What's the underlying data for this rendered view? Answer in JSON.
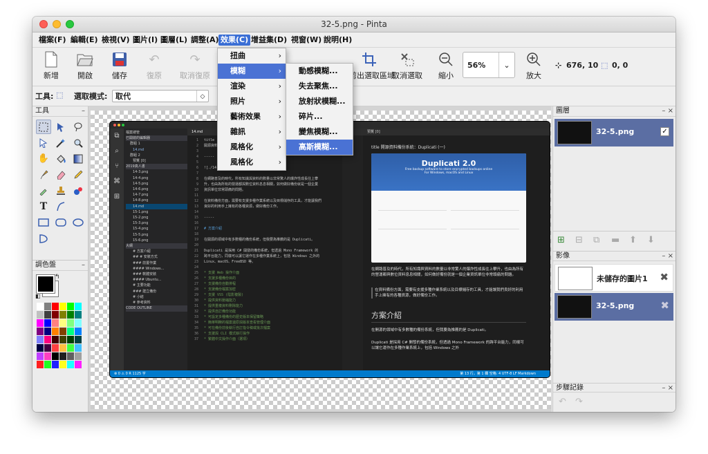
{
  "window": {
    "title": "32-5.png - Pinta"
  },
  "menubar": [
    {
      "label": "檔案(F)"
    },
    {
      "label": "編輯(E)"
    },
    {
      "label": "檢視(V)"
    },
    {
      "label": "圖片(I)"
    },
    {
      "label": "圖層(L)"
    },
    {
      "label": "調整(A)"
    },
    {
      "label": "效果(C)"
    },
    {
      "label": "增益集(D)"
    },
    {
      "label": "視窗(W)"
    },
    {
      "label": "說明(H)"
    }
  ],
  "toolbar": {
    "new": "新增",
    "open": "開啟",
    "save": "儲存",
    "undo": "復原",
    "redo": "取消復原",
    "crop": "裁剪出選取區域",
    "deselect": "取消選取",
    "zoom_out": "縮小",
    "zoom_in": "放大",
    "zoom_value": "56%",
    "cursor_pos": "676, 10",
    "selection_size": "0, 0"
  },
  "toolrow": {
    "tool_label": "工具:",
    "select_mode_label": "選取模式:",
    "select_mode_value": "取代"
  },
  "effects_menu": [
    {
      "label": "扭曲"
    },
    {
      "label": "模糊"
    },
    {
      "label": "渲染"
    },
    {
      "label": "照片"
    },
    {
      "label": "藝術效果"
    },
    {
      "label": "雜訊"
    },
    {
      "label": "風格化"
    },
    {
      "label": "風格化"
    }
  ],
  "blur_submenu": [
    {
      "label": "動感模糊..."
    },
    {
      "label": "失去聚焦..."
    },
    {
      "label": "放射狀模糊..."
    },
    {
      "label": "碎片..."
    },
    {
      "label": "變焦模糊..."
    },
    {
      "label": "高斯模糊..."
    }
  ],
  "panels": {
    "tools": "工具",
    "palette": "調色盤",
    "layers": "圖層",
    "images": "影像",
    "history": "步驟記錄",
    "minimize": "–",
    "close": "×"
  },
  "layers": [
    {
      "name": "32-5.png",
      "visible": true
    }
  ],
  "images": [
    {
      "name": "未儲存的圖片1"
    },
    {
      "name": "32-5.png"
    }
  ],
  "screenshot_content": {
    "sidebar_title": "檔案總管",
    "sidebar_section": "已開啟的編輯器",
    "group1": "群組 1",
    "open_file": "14.md",
    "group2": "群組 2",
    "preview_item": "預覽 [0]",
    "folder": "2019真人書",
    "files": [
      "14-3.png",
      "14-4.png",
      "14-5.png",
      "14-6.png",
      "14-7.png",
      "14-8.png",
      "14.md",
      "15-1.png",
      "15-2.png",
      "15-3.png",
      "15-4.png",
      "15-5.png",
      "15-6.png"
    ],
    "outline_label": "大綱",
    "outline_items": [
      "# 方案介紹",
      "## # 安裝方式",
      "### 前置作業",
      "#### Windows...",
      "### 軟體安裝",
      "#### Ubuntu...",
      "# 主要功能",
      "### 建立備份",
      "# 小結",
      "# 參考資料"
    ],
    "code_outline": "CODE OUTLINE",
    "editor_tab": "14.md",
    "preview_tab": "預覽 [0]",
    "code_lines": [
      {
        "n": "1",
        "t": "title"
      },
      {
        "n": "2",
        "t": "開源資料備份系統：Duplicati (一)"
      },
      {
        "n": "3",
        "t": ""
      },
      {
        "n": "4",
        "t": "-----"
      },
      {
        "n": "5",
        "t": ""
      },
      {
        "n": "6",
        "t": "![./14-1.png](./14-1.png)"
      },
      {
        "n": "7",
        "t": ""
      },
      {
        "n": "8",
        "t": "在網路普及的時代，所有知識與資料的數量以非常驚人的爆炸性成長往上攀"
      },
      {
        "n": "9",
        "t": "升，也由為所有的營運都與數位資料息息相關，如何做好備份就是一個企業"
      },
      {
        "n": "10",
        "t": "資訊單位非常頭痛的問題。"
      },
      {
        "n": "11",
        "t": ""
      },
      {
        "n": "12",
        "t": "在資料備份方面，需要有支援多種作業系統以及目標儲存的工具，才能讓我們"
      },
      {
        "n": "13",
        "t": "良好的利用手上擁有的各種資源，做好備份工作。"
      },
      {
        "n": "14",
        "t": ""
      },
      {
        "n": "15",
        "t": "-----"
      },
      {
        "n": "16",
        "t": ""
      },
      {
        "n": "17",
        "t": "# 方案介紹"
      },
      {
        "n": "18",
        "t": ""
      },
      {
        "n": "19",
        "t": "在開源的領域中有多數種的備份系統，但我要為推薦的是 Duplicati。"
      },
      {
        "n": "20",
        "t": ""
      },
      {
        "n": "21",
        "t": "Duplicati 是採用 C# 開發的備份系統，但透過 Mono Framework 的"
      },
      {
        "n": "22",
        "t": "跨平台能力，同樣可以讓它運作在多種作業系統上，包括 Windows 之外的"
      },
      {
        "n": "23",
        "t": "Linux、macOS、FreeBSD 等。"
      },
      {
        "n": "24",
        "t": ""
      },
      {
        "n": "25",
        "t": "* 支援 Web 操作介面"
      },
      {
        "n": "26",
        "t": "* 支援多種備份目的"
      },
      {
        "n": "27",
        "t": "* 支援備份自動排程"
      },
      {
        "n": "28",
        "t": "* 支援備份檔案加密"
      },
      {
        "n": "29",
        "t": "* 支援 VSS (陰影複製)"
      },
      {
        "n": "30",
        "t": "* 提供資料壓縮能力"
      },
      {
        "n": "31",
        "t": "* 提供重複資料刪除能力"
      },
      {
        "n": "32",
        "t": "* 提供自訂備份功能"
      },
      {
        "n": "33",
        "t": "* 可設定多種備份的歷史版本保留策略"
      },
      {
        "n": "34",
        "t": "* 簡單明瞭的檔案還原與版本查看管理介面"
      },
      {
        "n": "35",
        "t": "* 可在備份前後執行自訂指令稿或批次檔案"
      },
      {
        "n": "36",
        "t": "* 支援與 CLI 模式執行操作"
      },
      {
        "n": "37",
        "t": "* 繁體中文操作介面（選項）"
      }
    ],
    "preview": {
      "h_title": "title 開源資料備份系統：Duplicati (一)",
      "hero_title": "Duplicati 2.0",
      "hero_sub": "Free backup software to store encrypted backups online",
      "hero_sub2": "For Windows, macOS and Linux",
      "p1": "在網路普及的時代，所有知識與資料的數量以非常驚人的爆炸性成長往上攀升，也由為所有的營運都與數位資料息息相關，如何做好備份就是一個企業資訊單位非常頭痛的問題。",
      "p2": "在資料備份方面，需要有支援多種作業系統以及目標儲存的工具，才能讓我們良好的利用手上擁有的各種資源，做好備份工作。",
      "h2": "方案介紹",
      "p3": "在開源的領域中有多數種的備份系統，但我要為推薦的是 Duplicati。",
      "p4": "Duplicati 是採用 C# 開發的備份系統，但透過 Mono Framework 的跨平台能力，同樣可以讓它運作在多種作業系統上，包括 Windows 之外"
    },
    "statusbar_left": "⊗ 0 ⚠ 0    R 1125 字",
    "statusbar_right": "第 13 行，第 1 欄   空格: 4   UTF-8   LF   Markdown"
  },
  "colors": {
    "accent": "#3b6fd6",
    "highlight": "#4a72d4",
    "layer_sel": "#5b6ea3",
    "vscode_blue": "#007acc"
  }
}
